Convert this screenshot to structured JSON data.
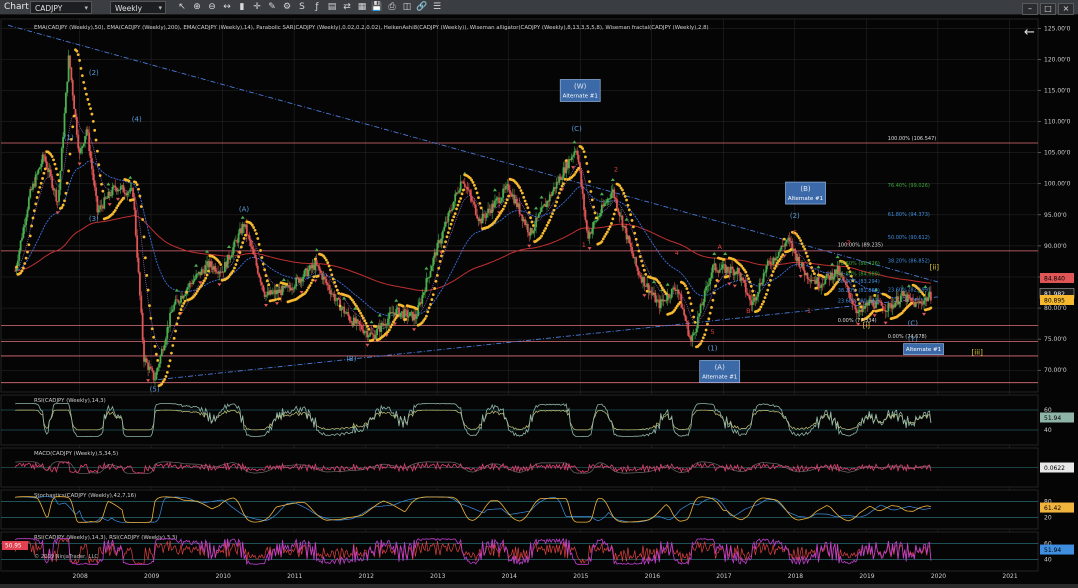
{
  "toolbar": {
    "title": "Chart",
    "instrument": "CADJPY",
    "period": "Weekly",
    "icons": [
      "cursor-icon",
      "zoom-in-icon",
      "zoom-out-icon",
      "scroll-icon",
      "bars-icon",
      "crosshair-icon",
      "drawing-tools-icon",
      "properties-icon",
      "strategy-icon",
      "indicator-icon",
      "data-box-icon",
      "chart-trader-icon",
      "grid-icon",
      "save-icon",
      "print-icon",
      "screenshot-icon",
      "link-icon",
      "menu-icon"
    ],
    "window_buttons": [
      "minimize-icon",
      "maximize-icon",
      "close-icon"
    ]
  },
  "indicator_text": "EMA(CADJPY (Weekly),50), EMA(CADJPY (Weekly),200), EMA(CADJPY (Weekly),14), Parabolic SAR(CADJPY (Weekly),0.02,0.2,0.02), HeikenAshi8(CADJPY (Weekly)), Wiseman alligator(CADJPY (Weekly),8,13,3,5,5,8), Wiseman fractal(CADJPY (Weekly),2,8)",
  "copyright": "© 2019 NinjaTrader, LLC",
  "back_arrow": "←",
  "colors": {
    "background": "#050505",
    "grid": "#2a2a2a",
    "bull": "#4caf50",
    "bear": "#e05555",
    "sar": "#f5b82e",
    "ema50": "#3f6fe0",
    "ema200": "#c03030",
    "trendline": "#4a7bd8",
    "hline": "#e0707a",
    "fib_green": "#3ca83c",
    "fib_blue": "#3f8ee0",
    "label_blue": "#5b9bd5",
    "label_red": "#e04040",
    "label_yellow": "#e8d33a"
  },
  "chart_data": {
    "type": "candlestick",
    "title": "",
    "instrument": "CADJPY",
    "period": "Weekly",
    "x_ticks": [
      "2008",
      "2009",
      "2010",
      "2011",
      "2012",
      "2013",
      "2014",
      "2015",
      "2016",
      "2017",
      "2018",
      "2019",
      "2020",
      "2021"
    ],
    "y_ticks": [
      "125.00'0",
      "120.00'0",
      "115.00'0",
      "110.00'0",
      "105.00'0",
      "100.00'0",
      "95.00'0",
      "90.00'0",
      "85.00'0",
      "80.00'0",
      "75.00'0",
      "70.00'0"
    ],
    "ylim": [
      66.5,
      126.5
    ],
    "price_path": [
      [
        2007.1,
        86.0
      ],
      [
        2007.3,
        98.0
      ],
      [
        2007.5,
        104.5
      ],
      [
        2007.7,
        97.0
      ],
      [
        2007.85,
        120.5
      ],
      [
        2008.0,
        104.5
      ],
      [
        2008.1,
        109.0
      ],
      [
        2008.25,
        95.5
      ],
      [
        2008.5,
        99.5
      ],
      [
        2008.75,
        98.5
      ],
      [
        2008.9,
        72.0
      ],
      [
        2009.05,
        68.5
      ],
      [
        2009.3,
        80.0
      ],
      [
        2009.55,
        84.0
      ],
      [
        2009.8,
        87.0
      ],
      [
        2010.0,
        86.0
      ],
      [
        2010.3,
        93.5
      ],
      [
        2010.6,
        82.0
      ],
      [
        2010.9,
        83.0
      ],
      [
        2011.3,
        87.0
      ],
      [
        2011.6,
        81.0
      ],
      [
        2011.8,
        78.0
      ],
      [
        2012.1,
        75.5
      ],
      [
        2012.4,
        79.5
      ],
      [
        2012.7,
        78.5
      ],
      [
        2012.95,
        88.0
      ],
      [
        2013.35,
        101.0
      ],
      [
        2013.6,
        94.0
      ],
      [
        2014.0,
        99.5
      ],
      [
        2014.3,
        92.0
      ],
      [
        2014.6,
        98.5
      ],
      [
        2014.95,
        106.0
      ],
      [
        2015.1,
        91.5
      ],
      [
        2015.45,
        99.0
      ],
      [
        2015.8,
        86.0
      ],
      [
        2016.1,
        80.5
      ],
      [
        2016.35,
        83.5
      ],
      [
        2016.55,
        74.5
      ],
      [
        2016.85,
        86.5
      ],
      [
        2017.2,
        86.0
      ],
      [
        2017.4,
        80.5
      ],
      [
        2017.6,
        86.5
      ],
      [
        2017.9,
        91.0
      ],
      [
        2018.15,
        85.5
      ],
      [
        2018.35,
        84.0
      ],
      [
        2018.6,
        86.0
      ],
      [
        2018.9,
        79.0
      ],
      [
        2019.05,
        81.0
      ],
      [
        2019.3,
        80.0
      ],
      [
        2019.5,
        82.0
      ],
      [
        2019.7,
        80.5
      ],
      [
        2019.9,
        82.0
      ]
    ],
    "current_price": "81.982",
    "price_tags": [
      {
        "label": "84.840",
        "value": 84.84,
        "color": "#e05555",
        "text": "#000"
      },
      {
        "label": "81.982",
        "value": 82.35,
        "color": "#1a1a1a",
        "text": "#fff",
        "border": "#aaa"
      },
      {
        "label": "80.895",
        "value": 81.3,
        "color": "#f5b82e",
        "text": "#000"
      }
    ],
    "h_lines": [
      106.55,
      89.2,
      77.2,
      74.6,
      72.3,
      68.0
    ],
    "trendlines": [
      {
        "from": [
          2007.0,
          125.5
        ],
        "to": [
          2020.0,
          84.2
        ]
      },
      {
        "from": [
          2009.1,
          68.5
        ],
        "to": [
          2020.0,
          81.8
        ]
      }
    ],
    "fib_left": [
      {
        "text": "100.00% (89.235)",
        "at": [
          2018.6,
          89.9
        ],
        "color": "#dcdcdc"
      },
      {
        "text": "78.60% (86.426)",
        "at": [
          2018.6,
          86.9
        ],
        "color": "#3ca83c"
      },
      {
        "text": "61.80% (84.689)",
        "at": [
          2018.6,
          85.2
        ],
        "color": "#3ca83c"
      },
      {
        "text": "50.00% (83.294)",
        "at": [
          2018.6,
          84.0
        ],
        "color": "#3f8ee0"
      },
      {
        "text": "38.20% (81.880)",
        "at": [
          2018.6,
          82.6
        ],
        "color": "#3f8ee0"
      },
      {
        "text": "23.60% (80.142)",
        "at": [
          2018.6,
          80.9
        ],
        "color": "#3f8ee0"
      },
      {
        "text": "0.00% (77.334)",
        "at": [
          2018.6,
          77.8
        ],
        "color": "#dcdcdc"
      }
    ],
    "fib_right": [
      {
        "text": "100.00% (106.547)",
        "at": [
          2019.3,
          107.0
        ],
        "color": "#dcdcdc"
      },
      {
        "text": "76.40% (99.026)",
        "at": [
          2019.3,
          99.5
        ],
        "color": "#3ca83c"
      },
      {
        "text": "61.80% (94.373)",
        "at": [
          2019.3,
          94.8
        ],
        "color": "#3f8ee0"
      },
      {
        "text": "50.00% (90.612)",
        "at": [
          2019.3,
          91.1
        ],
        "color": "#3f8ee0"
      },
      {
        "text": "38.20% (86.852)",
        "at": [
          2019.3,
          87.3
        ],
        "color": "#3f8ee0"
      },
      {
        "text": "23.60% (82.199)",
        "at": [
          2019.3,
          82.7
        ],
        "color": "#3f8ee0"
      },
      {
        "text": "0.00% (74.678)",
        "at": [
          2019.3,
          75.2
        ],
        "color": "#dcdcdc"
      }
    ],
    "wave_labels": [
      {
        "text": "(1)",
        "at": [
          2007.85,
          107.0
        ],
        "color": "#5b9bd5"
      },
      {
        "text": "(2)",
        "at": [
          2008.2,
          117.5
        ],
        "color": "#5b9bd5"
      },
      {
        "text": "(3)",
        "at": [
          2008.2,
          94.0
        ],
        "color": "#5b9bd5"
      },
      {
        "text": "(4)",
        "at": [
          2008.8,
          110.0
        ],
        "color": "#5b9bd5"
      },
      {
        "text": "(5)",
        "at": [
          2009.05,
          66.6
        ],
        "color": "#5b9bd5"
      },
      {
        "text": "(A)",
        "at": [
          2010.3,
          95.5
        ],
        "color": "#5b9bd5"
      },
      {
        "text": "(B)",
        "at": [
          2011.8,
          71.5
        ],
        "color": "#5b9bd5"
      },
      {
        "text": "(C)",
        "at": [
          2014.95,
          108.5
        ],
        "color": "#5b9bd5"
      },
      {
        "text": "(1)",
        "at": [
          2016.85,
          73.2
        ],
        "color": "#5b9bd5"
      },
      {
        "text": "(2)",
        "at": [
          2018.0,
          94.5
        ],
        "color": "#5b9bd5"
      },
      {
        "text": "(C)",
        "at": [
          2019.65,
          77.2
        ],
        "color": "#5b9bd5"
      },
      {
        "text": "(Y)",
        "at": [
          2019.65,
          74.6
        ],
        "color": "#5b9bd5"
      },
      {
        "text": "1",
        "at": [
          2015.05,
          89.8
        ],
        "color": "#e04040"
      },
      {
        "text": "2",
        "at": [
          2015.5,
          102.0
        ],
        "color": "#e04040"
      },
      {
        "text": "4",
        "at": [
          2016.35,
          88.5
        ],
        "color": "#e04040"
      },
      {
        "text": "5",
        "at": [
          2016.85,
          75.8
        ],
        "color": "#e04040"
      },
      {
        "text": "A",
        "at": [
          2016.95,
          89.5
        ],
        "color": "#e04040"
      },
      {
        "text": "B",
        "at": [
          2017.35,
          79.2
        ],
        "color": "#e04040"
      },
      {
        "text": "C",
        "at": [
          2018.0,
          91.8
        ],
        "color": "#e04040"
      },
      {
        "text": "1",
        "at": [
          2018.2,
          79.2
        ],
        "color": "#e04040"
      },
      {
        "text": "2",
        "at": [
          2018.75,
          90.2
        ],
        "color": "#e04040"
      },
      {
        "text": "[i]",
        "at": [
          2019.0,
          76.9
        ],
        "color": "#e8d33a"
      },
      {
        "text": "[ii]",
        "at": [
          2019.95,
          86.2
        ],
        "color": "#e8d33a"
      },
      {
        "text": "[iii]",
        "at": [
          2020.55,
          72.5
        ],
        "color": "#e8d33a"
      }
    ],
    "boxes": [
      {
        "title": "(W)",
        "sub": "Alternate #1",
        "at": [
          2015.0,
          115.0
        ]
      },
      {
        "title": "(B)",
        "sub": "Alternate #1",
        "at": [
          2018.15,
          98.5
        ]
      },
      {
        "title": "(A)",
        "sub": "Alternate #1",
        "at": [
          2016.95,
          69.8
        ]
      },
      {
        "title": "",
        "sub": "Alternate #1",
        "at": [
          2019.8,
          73.4
        ]
      }
    ]
  },
  "panels": [
    {
      "name": "rsi-panel",
      "label": "RSI(CADJPY (Weekly),14,3)",
      "value": "51.94",
      "tag_color": "#8fb4a8",
      "ticks": [
        "60",
        "40"
      ],
      "series_color": "#8fb4a8",
      "series2_color": "#c8c87a"
    },
    {
      "name": "macd-panel",
      "label": "MACD(CADJPY (Weekly),5,34,5)",
      "value": "0.0622",
      "tag_color": "#e8e8e8",
      "ticks": [],
      "series_color": "#e04070",
      "series2_color": "#6a6a6a"
    },
    {
      "name": "stochastics-panel",
      "label": "Stochastics(CADJPY (Weekly),42,7,16)",
      "value": "61.42",
      "tag_color": "#f0b43c",
      "ticks": [
        "80",
        "20"
      ],
      "series_color": "#f0b43c",
      "series2_color": "#3f8ee0"
    },
    {
      "name": "rsi-rsi-panel",
      "label": "RSI(CADJPY (Weekly),14,3), RSI(CADJPY (Weekly),3,3)",
      "value": "51.94",
      "tag_color": "#3f8ee0",
      "ticks": [
        "60",
        "40"
      ],
      "series_color": "#c040d0",
      "series2_color": "#e04040",
      "left_value": "50.95"
    }
  ]
}
